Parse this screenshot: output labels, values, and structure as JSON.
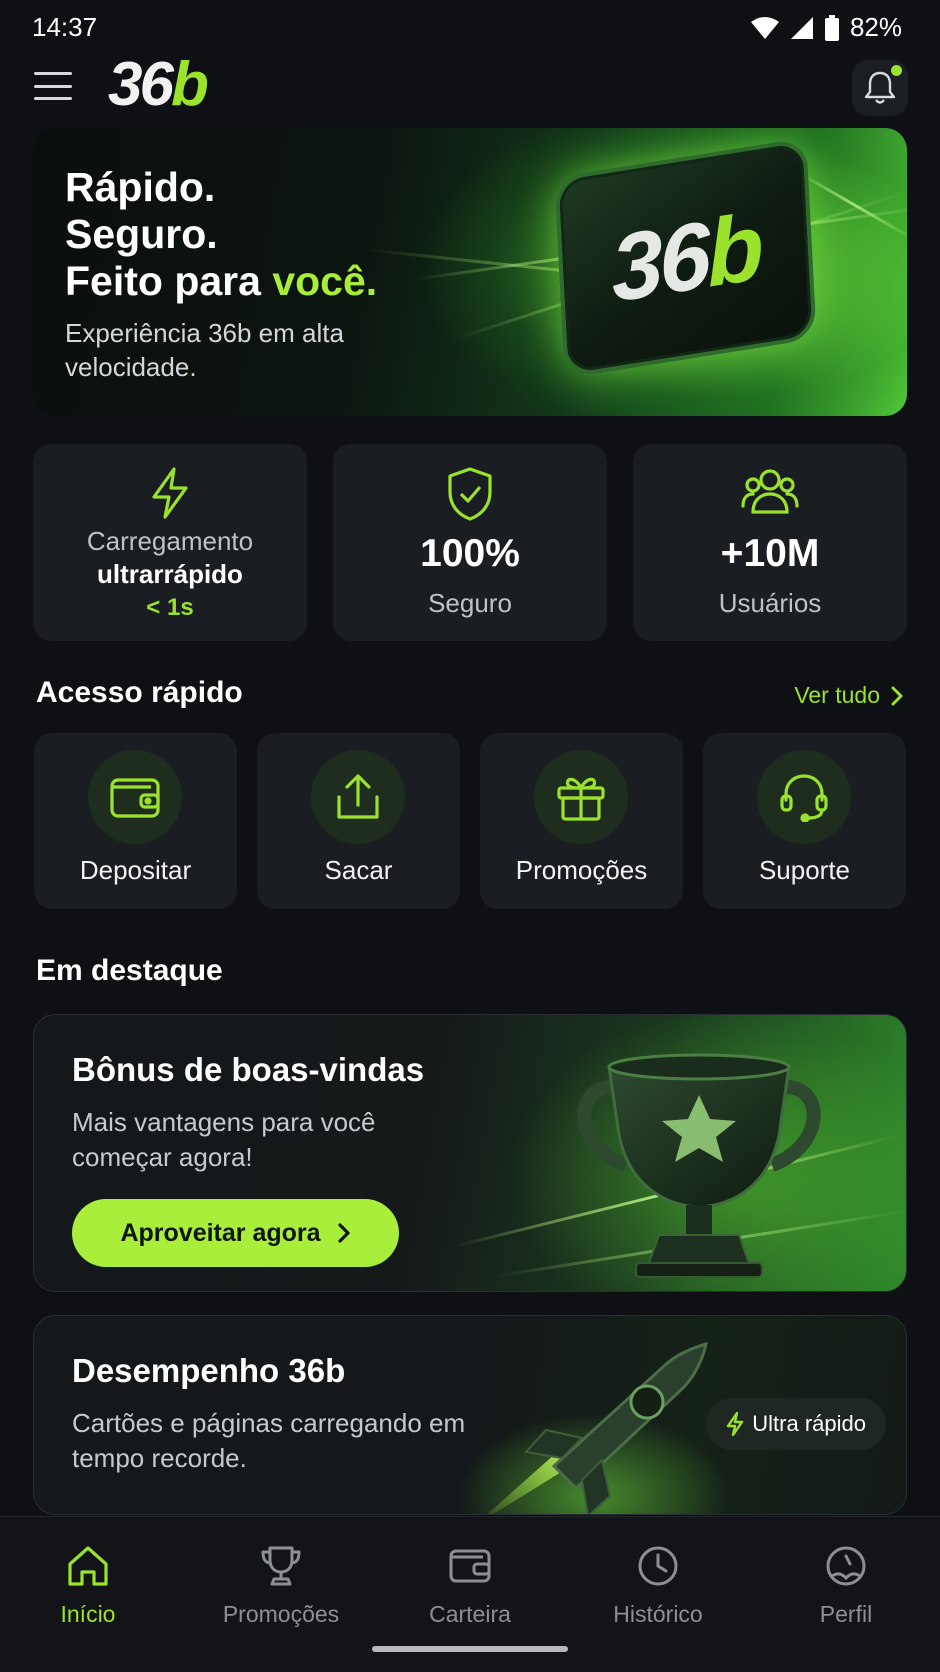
{
  "status_bar": {
    "time": "14:37",
    "battery": "82%"
  },
  "header": {
    "logo_num": "36",
    "logo_b": "b"
  },
  "hero": {
    "line1": "Rápido.",
    "line2": "Seguro.",
    "line3_start": "Feito para ",
    "line3_accent": "você.",
    "subtitle": "Experiência 36b em alta velocidade.",
    "badge_num": "36",
    "badge_b": "b"
  },
  "stats": [
    {
      "line1": "Carregamento",
      "line2": "ultrarrápido",
      "line3": "< 1s",
      "icon": "bolt-icon"
    },
    {
      "value": "100%",
      "label": "Seguro",
      "icon": "shield-check-icon"
    },
    {
      "value": "+10M",
      "label": "Usuários",
      "icon": "users-icon"
    }
  ],
  "quick_access": {
    "title": "Acesso rápido",
    "see_all": "Ver tudo",
    "items": [
      {
        "label": "Depositar",
        "icon": "wallet-icon"
      },
      {
        "label": "Sacar",
        "icon": "upload-icon"
      },
      {
        "label": "Promoções",
        "icon": "gift-icon"
      },
      {
        "label": "Suporte",
        "icon": "headset-icon"
      }
    ]
  },
  "featured": {
    "title": "Em destaque",
    "bonus": {
      "title": "Bônus de boas-vindas",
      "subtitle": "Mais vantagens para você começar agora!",
      "button": "Aproveitar agora"
    },
    "performance": {
      "title": "Desempenho 36b",
      "subtitle": "Cartões e páginas carregando em tempo recorde.",
      "badge": "Ultra rápido"
    }
  },
  "bottom_nav": [
    {
      "label": "Início",
      "icon": "home-icon",
      "active": true
    },
    {
      "label": "Promoções",
      "icon": "trophy-icon"
    },
    {
      "label": "Carteira",
      "icon": "wallet-icon"
    },
    {
      "label": "Histórico",
      "icon": "clock-icon"
    },
    {
      "label": "Perfil",
      "icon": "profile-icon"
    }
  ],
  "colors": {
    "accent": "#9be22d",
    "background": "#0e1014",
    "card": "#1a1d21"
  }
}
